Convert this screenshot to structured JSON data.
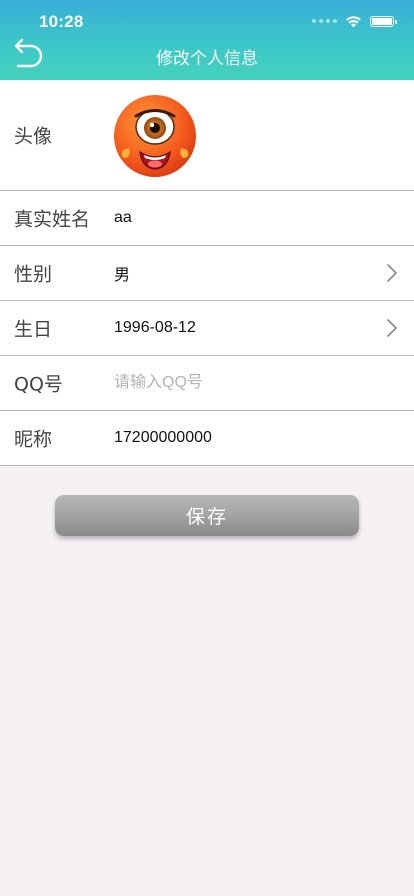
{
  "status_bar": {
    "time": "10:28"
  },
  "header": {
    "title": "修改个人信息"
  },
  "form": {
    "avatar_label": "头像",
    "real_name": {
      "label": "真实姓名",
      "value": "aa"
    },
    "gender": {
      "label": "性别",
      "value": "男"
    },
    "birthday": {
      "label": "生日",
      "value": "1996-08-12"
    },
    "qq": {
      "label": "QQ号",
      "value": "",
      "placeholder": "请输入QQ号"
    },
    "nickname": {
      "label": "昵称",
      "value": "17200000000"
    }
  },
  "save_button": {
    "label": "保存"
  },
  "icons": {
    "back": "back-arrow-icon",
    "chevron": "chevron-right-icon",
    "wifi": "wifi-icon",
    "battery": "battery-icon",
    "signal": "signal-icon"
  },
  "colors": {
    "header_top": "#3aaed8",
    "header_bottom": "#45d1bd",
    "page_background": "#f5f0f4",
    "button": "#a3a3a3",
    "divider": "#b7b7b7"
  }
}
